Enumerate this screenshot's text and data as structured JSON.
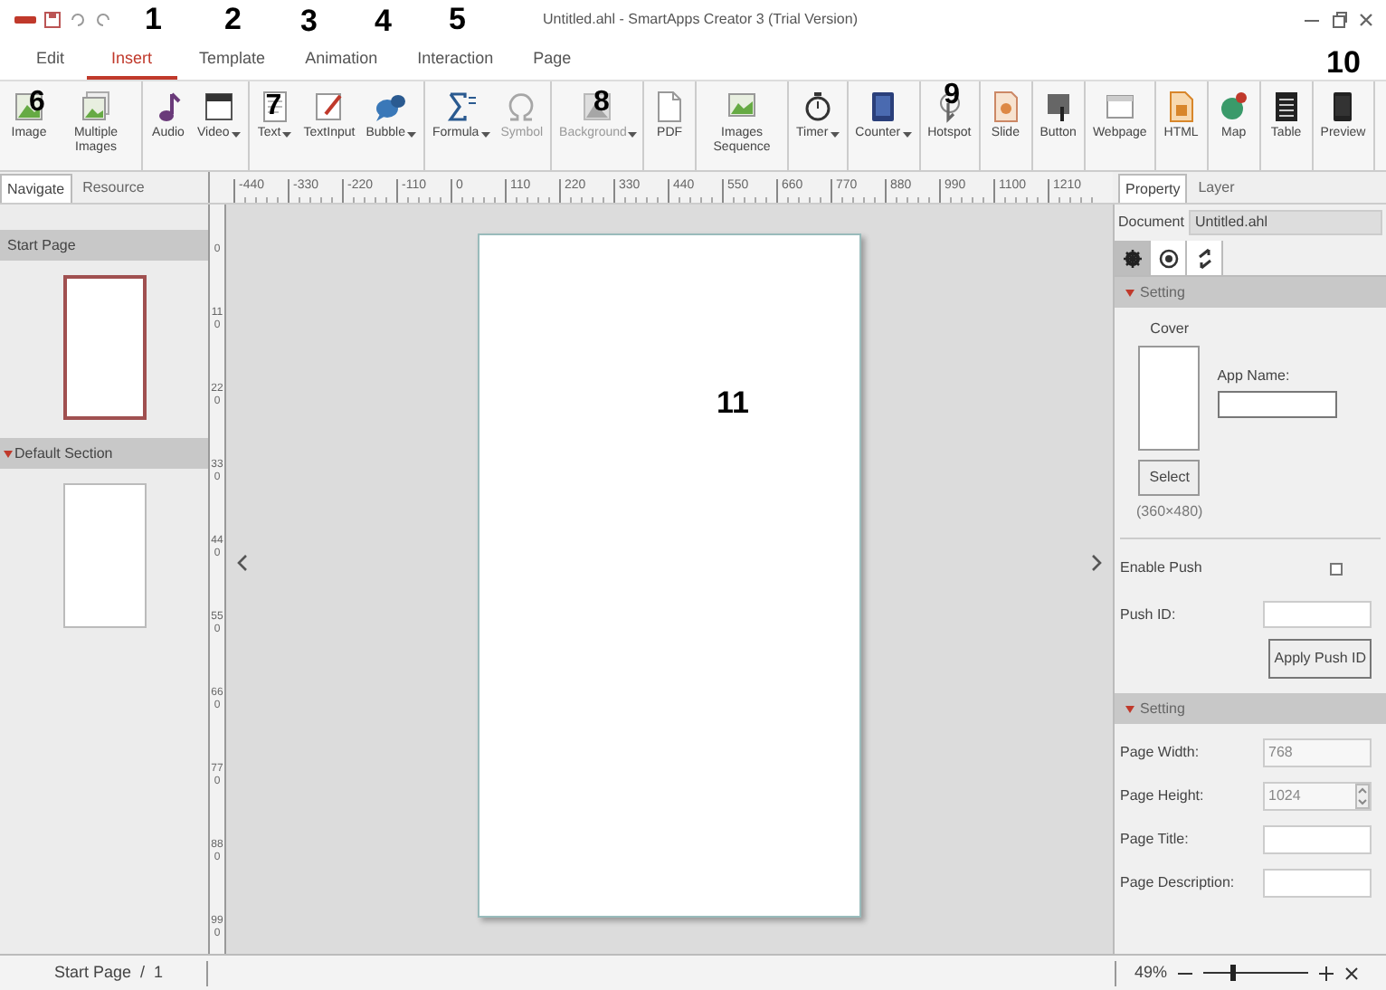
{
  "title_bar": {
    "title": "Untitled.ahl - SmartApps Creator 3 (Trial Version)"
  },
  "menu_tabs": [
    {
      "label": "Edit",
      "selected": false
    },
    {
      "label": "Insert",
      "selected": true
    },
    {
      "label": "Template",
      "selected": false
    },
    {
      "label": "Animation",
      "selected": false
    },
    {
      "label": "Interaction",
      "selected": false
    },
    {
      "label": "Page",
      "selected": false
    }
  ],
  "toolbar_groups": [
    [
      {
        "label": "Image",
        "dropdown": false,
        "disabled": false
      },
      {
        "label": "Multiple Images",
        "dropdown": false,
        "disabled": false
      }
    ],
    [
      {
        "label": "Audio",
        "dropdown": false,
        "disabled": false
      },
      {
        "label": "Video",
        "dropdown": true,
        "disabled": false
      }
    ],
    [
      {
        "label": "Text",
        "dropdown": true,
        "disabled": false
      },
      {
        "label": "TextInput",
        "dropdown": false,
        "disabled": false
      },
      {
        "label": "Bubble",
        "dropdown": true,
        "disabled": false
      }
    ],
    [
      {
        "label": "Formula",
        "dropdown": true,
        "disabled": false
      },
      {
        "label": "Symbol",
        "dropdown": false,
        "disabled": true
      }
    ],
    [
      {
        "label": "Background",
        "dropdown": true,
        "disabled": true
      }
    ],
    [
      {
        "label": "PDF",
        "dropdown": false,
        "disabled": false
      }
    ],
    [
      {
        "label": "Images Sequence",
        "dropdown": false,
        "disabled": false
      }
    ],
    [
      {
        "label": "Timer",
        "dropdown": true,
        "disabled": false
      }
    ],
    [
      {
        "label": "Counter",
        "dropdown": true,
        "disabled": false
      }
    ],
    [
      {
        "label": "Hotspot",
        "dropdown": false,
        "disabled": false
      }
    ],
    [
      {
        "label": "Slide",
        "dropdown": false,
        "disabled": false
      }
    ],
    [
      {
        "label": "Button",
        "dropdown": false,
        "disabled": false
      }
    ],
    [
      {
        "label": "Webpage",
        "dropdown": false,
        "disabled": false
      }
    ],
    [
      {
        "label": "HTML",
        "dropdown": false,
        "disabled": false
      }
    ],
    [
      {
        "label": "Map",
        "dropdown": false,
        "disabled": false
      }
    ],
    [
      {
        "label": "Table",
        "dropdown": false,
        "disabled": false
      }
    ],
    [
      {
        "label": "Preview",
        "dropdown": false,
        "disabled": false
      }
    ]
  ],
  "ruler_labels": [
    "-440",
    "-330",
    "-220",
    "-110",
    "0",
    "110",
    "220",
    "330",
    "440",
    "550",
    "660",
    "770",
    "880",
    "990",
    "1100",
    "1210"
  ],
  "vertical_ruler_labels": [
    "0",
    "110",
    "220",
    "330",
    "440",
    "550",
    "660",
    "770",
    "880",
    "990"
  ],
  "left_panel": {
    "tabs": [
      {
        "label": "Navigate",
        "selected": true
      },
      {
        "label": "Resource",
        "selected": false
      }
    ],
    "sections": [
      {
        "title": "Start Page",
        "kind": "page",
        "thumbnails": [
          {
            "selected": true
          }
        ]
      },
      {
        "title": "Default Section",
        "kind": "section",
        "thumbnails": [
          {
            "selected": false
          }
        ]
      }
    ]
  },
  "right_panel": {
    "tabs": [
      {
        "label": "Property",
        "selected": true
      },
      {
        "label": "Layer",
        "selected": false
      }
    ],
    "document": {
      "label": "Document",
      "value": "Untitled.ahl"
    },
    "icon_tabs": [
      {
        "selected": true
      },
      {
        "selected": false
      },
      {
        "selected": false
      }
    ],
    "app_setting": {
      "title": "Setting",
      "cover_label": "Cover",
      "app_name_label": "App Name:",
      "select_button": "Select",
      "cover_size": "(360×480)",
      "enable_push_label": "Enable Push",
      "enable_push_checked": false,
      "push_id_label": "Push ID:",
      "apply_button": "Apply Push ID"
    },
    "page_setting": {
      "title": "Setting",
      "fields": [
        {
          "label": "Page Width:",
          "value": "768",
          "kind": "disabled"
        },
        {
          "label": "Page Height:",
          "value": "1024",
          "kind": "spinner"
        },
        {
          "label": "Page Title:",
          "kind": "text"
        },
        {
          "label": "Page Description:",
          "kind": "text"
        }
      ]
    }
  },
  "status_bar": {
    "page": "Start Page  /  1",
    "zoom": "49%",
    "zoom_slider": {
      "level": 0.28
    }
  },
  "callouts": [
    {
      "label": "1"
    },
    {
      "label": "2"
    },
    {
      "label": "3"
    },
    {
      "label": "4"
    },
    {
      "label": "5"
    },
    {
      "label": "6"
    },
    {
      "label": "7"
    },
    {
      "label": "8"
    },
    {
      "label": "9"
    },
    {
      "label": "10"
    },
    {
      "label": "11"
    }
  ]
}
